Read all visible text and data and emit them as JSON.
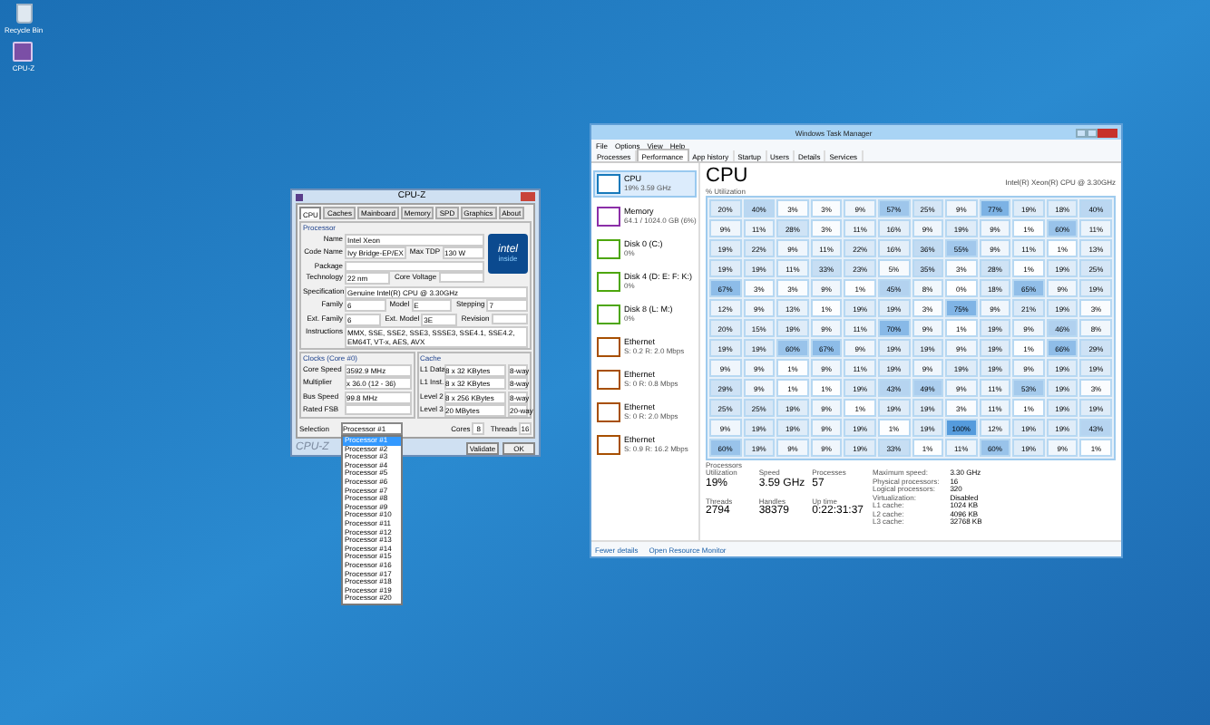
{
  "desktop_icons": [
    {
      "label": "Recycle Bin"
    },
    {
      "label": "CPU-Z"
    }
  ],
  "cpuz": {
    "title": "CPU-Z",
    "tabs": [
      {
        "label": "CPU",
        "selected": true
      },
      {
        "label": "Caches",
        "selected": false
      },
      {
        "label": "Mainboard",
        "selected": false
      },
      {
        "label": "Memory",
        "selected": false
      },
      {
        "label": "SPD",
        "selected": false
      },
      {
        "label": "Graphics",
        "selected": false
      },
      {
        "label": "About",
        "selected": false
      }
    ],
    "processor_group": "Processor",
    "processor_rows": [
      [
        {
          "label": "Name",
          "value": "Intel Xeon"
        }
      ],
      [
        {
          "label": "Code Name",
          "value": "Ivy Bridge-EP/EX"
        },
        {
          "label": "Max TDP",
          "value": "130 W"
        }
      ],
      [
        {
          "label": "Package"
        }
      ],
      [
        {
          "label": "Technology",
          "value": "22 nm"
        },
        {
          "label": "Core Voltage"
        }
      ],
      [
        {
          "label": "Specification",
          "value": "Genuine Intel(R) CPU @ 3.30GHz"
        }
      ],
      [
        {
          "label": "Family",
          "value": "6"
        },
        {
          "label": "Model",
          "value": "E"
        },
        {
          "label": "Stepping",
          "value": "7"
        }
      ],
      [
        {
          "label": "Ext. Family",
          "value": "6"
        },
        {
          "label": "Ext. Model",
          "value": "3E"
        },
        {
          "label": "Revision"
        }
      ],
      [
        {
          "label": "Instructions",
          "value": "MMX, SSE, SSE2, SSE3, SSSE3, SSE4.1, SSE4.2, EM64T, VT-x, AES, AVX"
        }
      ]
    ],
    "logo_text": "intel",
    "logo_sub": "inside",
    "clocks_group": "Clocks (Core #0)",
    "clocks_rows": [
      {
        "label": "Core Speed",
        "value": "3592.9 MHz"
      },
      {
        "label": "Multiplier",
        "value": "x 36.0 (12 - 36)"
      },
      {
        "label": "Bus Speed",
        "value": "99.8 MHz"
      },
      {
        "label": "Rated FSB"
      }
    ],
    "cache_group": "Cache",
    "cache_rows": [
      {
        "label": "L1 Data",
        "value": "8 x 32 KBytes",
        "ways": "8-way"
      },
      {
        "label": "L1 Inst.",
        "value": "8 x 32 KBytes",
        "ways": "8-way"
      },
      {
        "label": "Level 2",
        "value": "8 x 256 KBytes",
        "ways": "8-way"
      },
      {
        "label": "Level 3",
        "value": "20 MBytes",
        "ways": "20-way"
      }
    ],
    "selection_label": "Selection",
    "selection_value": "Processor #1",
    "cores_label": "Cores",
    "cores": "8",
    "threads_label": "Threads",
    "threads": "16",
    "brand": "CPU-Z",
    "buttons": [
      "Validate",
      "OK"
    ],
    "dropdown": [
      {
        "label": "Processor #1",
        "selected": true
      },
      {
        "label": "Processor #2",
        "selected": false
      },
      {
        "label": "Processor #3",
        "selected": false
      },
      {
        "label": "Processor #4",
        "selected": false
      },
      {
        "label": "Processor #5",
        "selected": false
      },
      {
        "label": "Processor #6",
        "selected": false
      },
      {
        "label": "Processor #7",
        "selected": false
      },
      {
        "label": "Processor #8",
        "selected": false
      },
      {
        "label": "Processor #9",
        "selected": false
      },
      {
        "label": "Processor #10",
        "selected": false
      },
      {
        "label": "Processor #11",
        "selected": false
      },
      {
        "label": "Processor #12",
        "selected": false
      },
      {
        "label": "Processor #13",
        "selected": false
      },
      {
        "label": "Processor #14",
        "selected": false
      },
      {
        "label": "Processor #15",
        "selected": false
      },
      {
        "label": "Processor #16",
        "selected": false
      },
      {
        "label": "Processor #17",
        "selected": false
      },
      {
        "label": "Processor #18",
        "selected": false
      },
      {
        "label": "Processor #19",
        "selected": false
      },
      {
        "label": "Processor #20",
        "selected": false
      }
    ]
  },
  "task_manager": {
    "title": "Windows Task Manager",
    "menu": [
      "File",
      "Options",
      "View",
      "Help"
    ],
    "tabs": [
      {
        "label": "Processes",
        "selected": false
      },
      {
        "label": "Performance",
        "selected": true
      },
      {
        "label": "App history",
        "selected": false
      },
      {
        "label": "Startup",
        "selected": false
      },
      {
        "label": "Users",
        "selected": false
      },
      {
        "label": "Details",
        "selected": false
      },
      {
        "label": "Services",
        "selected": false
      }
    ],
    "sidebar": [
      {
        "name": "CPU",
        "detail": "19% 3.59 GHz",
        "color": "#1779ba",
        "selected": true
      },
      {
        "name": "Memory",
        "detail": "64.1 / 1024.0 GB (6%)",
        "color": "#8b2fa8",
        "selected": false
      },
      {
        "name": "Disk 0 (C:)",
        "detail": "0%",
        "color": "#4da60c",
        "selected": false
      },
      {
        "name": "Disk 4 (D: E: F: K:)",
        "detail": "0%",
        "color": "#4da60c",
        "selected": false
      },
      {
        "name": "Disk 8 (L: M:)",
        "detail": "0%",
        "color": "#4da60c",
        "selected": false
      },
      {
        "name": "Ethernet",
        "detail": "S: 0.2 R: 2.0 Mbps",
        "color": "#a74f01",
        "selected": false
      },
      {
        "name": "Ethernet",
        "detail": "S: 0 R: 0.8 Mbps",
        "color": "#a74f01",
        "selected": false
      },
      {
        "name": "Ethernet",
        "detail": "S: 0 R: 2.0 Mbps",
        "color": "#a74f01",
        "selected": false
      },
      {
        "name": "Ethernet",
        "detail": "S: 0.9 R: 16.2 Mbps",
        "color": "#a74f01",
        "selected": false
      }
    ],
    "heading": "CPU",
    "cpu_model": "Intel(R) Xeon(R) CPU @ 3.30GHz",
    "grid_label": "% Utilization",
    "grid": [
      [
        "20%",
        "40%",
        "3%",
        "3%",
        "9%",
        "57%",
        "25%",
        "9%",
        "77%",
        "19%",
        "18%",
        "40%"
      ],
      [
        "9%",
        "11%",
        "28%",
        "3%",
        "11%",
        "16%",
        "9%",
        "19%",
        "9%",
        "1%",
        "60%",
        "11%"
      ],
      [
        "19%",
        "22%",
        "9%",
        "11%",
        "22%",
        "16%",
        "36%",
        "55%",
        "9%",
        "11%",
        "1%",
        "13%"
      ],
      [
        "19%",
        "19%",
        "11%",
        "33%",
        "23%",
        "5%",
        "35%",
        "3%",
        "28%",
        "1%",
        "19%",
        "25%"
      ],
      [
        "67%",
        "3%",
        "3%",
        "9%",
        "1%",
        "45%",
        "8%",
        "0%",
        "18%",
        "65%",
        "9%",
        "19%"
      ],
      [
        "12%",
        "9%",
        "13%",
        "1%",
        "19%",
        "19%",
        "3%",
        "75%",
        "9%",
        "21%",
        "19%",
        "3%"
      ],
      [
        "20%",
        "15%",
        "19%",
        "9%",
        "11%",
        "70%",
        "9%",
        "1%",
        "19%",
        "9%",
        "46%",
        "8%"
      ],
      [
        "19%",
        "19%",
        "60%",
        "67%",
        "9%",
        "19%",
        "19%",
        "9%",
        "19%",
        "1%",
        "66%",
        "29%"
      ],
      [
        "9%",
        "9%",
        "1%",
        "9%",
        "11%",
        "19%",
        "9%",
        "19%",
        "19%",
        "9%",
        "19%",
        "19%"
      ],
      [
        "29%",
        "9%",
        "1%",
        "1%",
        "19%",
        "43%",
        "49%",
        "9%",
        "11%",
        "53%",
        "19%",
        "3%"
      ],
      [
        "25%",
        "25%",
        "19%",
        "9%",
        "1%",
        "19%",
        "19%",
        "3%",
        "11%",
        "1%",
        "19%",
        "19%"
      ],
      [
        "9%",
        "19%",
        "19%",
        "9%",
        "19%",
        "1%",
        "19%",
        "100%",
        "12%",
        "19%",
        "19%",
        "43%"
      ],
      [
        "60%",
        "19%",
        "9%",
        "9%",
        "19%",
        "33%",
        "1%",
        "11%",
        "60%",
        "19%",
        "9%",
        "1%"
      ]
    ],
    "grid_footer": "Processors",
    "stats": [
      {
        "label": "Utilization",
        "value": "19%"
      },
      {
        "label": "Speed",
        "value": "3.59 GHz"
      },
      {
        "label": "Processes",
        "value": "57"
      },
      {
        "label": "Threads",
        "value": "2794"
      },
      {
        "label": "Handles",
        "value": "38379"
      },
      {
        "label": "Up time",
        "value": "0:22:31:37"
      }
    ],
    "details": [
      {
        "label": "Maximum speed:",
        "value": "3.30 GHz"
      },
      {
        "label": "Physical processors:",
        "value": "16"
      },
      {
        "label": "Logical processors:",
        "value": "320"
      },
      {
        "label": "Virtualization:",
        "value": "Disabled"
      },
      {
        "label": "L1 cache:",
        "value": "1024 KB"
      },
      {
        "label": "L2 cache:",
        "value": "4096 KB"
      },
      {
        "label": "L3 cache:",
        "value": "32768 KB"
      }
    ],
    "fewer_details": "Fewer details",
    "resource_monitor": "Open Resource Monitor"
  }
}
